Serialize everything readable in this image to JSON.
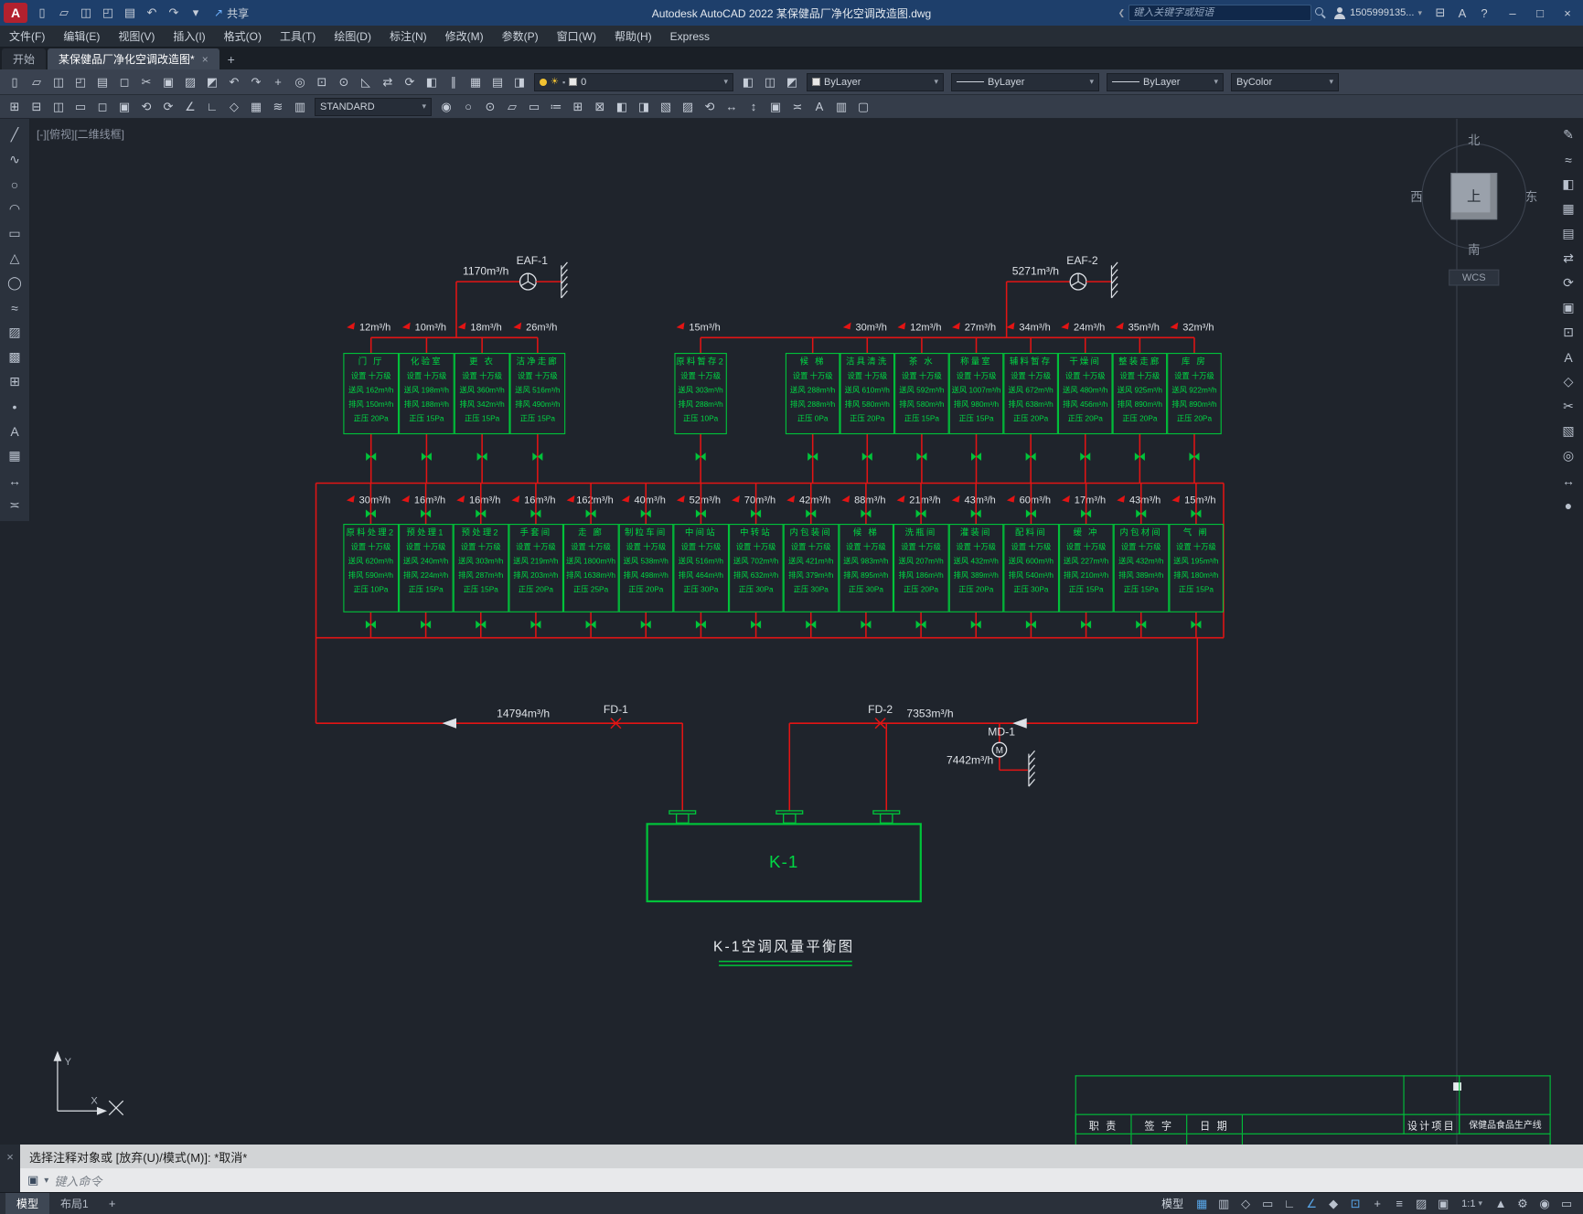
{
  "titlebar": {
    "logo": "A",
    "title": "Autodesk AutoCAD 2022   某保健品厂净化空调改造图.dwg",
    "share": "共享",
    "search_placeholder": "键入关键字或短语",
    "account": "1505999135...",
    "qat": [
      {
        "name": "new-file-icon",
        "glyph": "▯"
      },
      {
        "name": "open-file-icon",
        "glyph": "▱"
      },
      {
        "name": "save-icon",
        "glyph": "◫"
      },
      {
        "name": "save-as-icon",
        "glyph": "◰"
      },
      {
        "name": "plot-icon",
        "glyph": "▤"
      },
      {
        "name": "undo-icon",
        "glyph": "↶"
      },
      {
        "name": "redo-icon",
        "glyph": "↷"
      },
      {
        "name": "qat-menu-icon",
        "glyph": "▾"
      }
    ],
    "right_icons": [
      {
        "name": "cart-icon",
        "glyph": "⊟"
      },
      {
        "name": "autodesk-assistant-icon",
        "glyph": "A"
      },
      {
        "name": "help-icon",
        "glyph": "?"
      }
    ],
    "window_icons": [
      {
        "name": "minimize-button",
        "glyph": "–"
      },
      {
        "name": "maximize-button",
        "glyph": "□"
      },
      {
        "name": "close-button",
        "glyph": "×"
      }
    ]
  },
  "menubar": {
    "items": [
      "文件(F)",
      "编辑(E)",
      "视图(V)",
      "插入(I)",
      "格式(O)",
      "工具(T)",
      "绘图(D)",
      "标注(N)",
      "修改(M)",
      "参数(P)",
      "窗口(W)",
      "帮助(H)",
      "Express"
    ]
  },
  "filetabs": {
    "start": "开始",
    "doc": "某保健品厂净化空调改造图*",
    "close": "×",
    "add": "+"
  },
  "toolbar1": {
    "icons": [
      {
        "name": "new-file-icon",
        "glyph": "▯"
      },
      {
        "name": "open-file-icon",
        "glyph": "▱"
      },
      {
        "name": "save-icon",
        "glyph": "◫"
      },
      {
        "name": "save-as-icon",
        "glyph": "◰"
      },
      {
        "name": "plot-icon",
        "glyph": "▤"
      },
      {
        "name": "plot-preview-icon",
        "glyph": "◻"
      },
      {
        "name": "cut-icon",
        "glyph": "✂"
      },
      {
        "name": "copy-icon",
        "glyph": "▣"
      },
      {
        "name": "paste-icon",
        "glyph": "▨"
      },
      {
        "name": "match-properties-icon",
        "glyph": "◩"
      },
      {
        "name": "undo-icon",
        "glyph": "↶"
      },
      {
        "name": "redo-icon",
        "glyph": "↷"
      },
      {
        "name": "pan-icon",
        "glyph": "+"
      },
      {
        "name": "zoom-realtime-icon",
        "glyph": "◎"
      },
      {
        "name": "zoom-window-icon",
        "glyph": "⊡"
      },
      {
        "name": "zoom-previous-icon",
        "glyph": "⊙"
      },
      {
        "name": "erase-icon",
        "glyph": "◺"
      },
      {
        "name": "move-icon",
        "glyph": "⇄"
      },
      {
        "name": "rotate-icon",
        "glyph": "⟳"
      },
      {
        "name": "mirror-icon",
        "glyph": "◧"
      },
      {
        "name": "offset-icon",
        "glyph": "∥"
      },
      {
        "name": "array-icon",
        "glyph": "▦"
      }
    ],
    "layer_pre_icons": [
      {
        "name": "layer-properties-icon",
        "glyph": "▤"
      },
      {
        "name": "layer-states-icon",
        "glyph": "◨"
      }
    ],
    "layer_post_icons": [
      {
        "name": "make-layer-current-icon",
        "glyph": "◧"
      },
      {
        "name": "layer-previous-icon",
        "glyph": "◫"
      },
      {
        "name": "layer-isolate-icon",
        "glyph": "◩"
      }
    ],
    "layer_value": "0",
    "color_value": "ByLayer",
    "linetype_value": "ByLayer",
    "lineweight_value": "ByLayer",
    "plotstyle_value": "ByColor"
  },
  "toolbar2": {
    "icons_a": [
      {
        "name": "insert-block-icon",
        "glyph": "⊞"
      },
      {
        "name": "external-ref-icon",
        "glyph": "⊟"
      },
      {
        "name": "window-icon",
        "glyph": "◫"
      },
      {
        "name": "viewport-icon",
        "glyph": "▭"
      },
      {
        "name": "named-view-icon",
        "glyph": "◻"
      },
      {
        "name": "sheet-icon",
        "glyph": "▣"
      },
      {
        "name": "regen-icon",
        "glyph": "⟲"
      },
      {
        "name": "redraw-icon",
        "glyph": "⟳"
      },
      {
        "name": "angle-icon",
        "glyph": "∠"
      },
      {
        "name": "ortho-mode-icon",
        "glyph": "∟"
      },
      {
        "name": "isodraft-icon",
        "glyph": "◇"
      },
      {
        "name": "grid-icon",
        "glyph": "▦"
      },
      {
        "name": "multiline-icon",
        "glyph": "≋"
      },
      {
        "name": "layout-icon",
        "glyph": "▥"
      }
    ],
    "style_value": "STANDARD",
    "icons_b": [
      {
        "name": "point-style-icon",
        "glyph": "◉"
      },
      {
        "name": "circle-tool-icon",
        "glyph": "○"
      },
      {
        "name": "donut-icon",
        "glyph": "⊙"
      },
      {
        "name": "rectangle-tool-icon",
        "glyph": "▱"
      },
      {
        "name": "viewport2-icon",
        "glyph": "▭"
      },
      {
        "name": "dim-linear-icon",
        "glyph": "≔"
      },
      {
        "name": "table-icon",
        "glyph": "⊞"
      },
      {
        "name": "block-icon",
        "glyph": "⊠"
      },
      {
        "name": "mirror2-icon",
        "glyph": "◧"
      },
      {
        "name": "fillet-icon",
        "glyph": "◨"
      },
      {
        "name": "hatch-icon",
        "glyph": "▧"
      },
      {
        "name": "gradient-icon",
        "glyph": "▨"
      }
    ],
    "icons_c": [
      {
        "name": "rotate2-icon",
        "glyph": "⟲"
      },
      {
        "name": "stretch-h-icon",
        "glyph": "↔"
      },
      {
        "name": "stretch-v-icon",
        "glyph": "↕"
      },
      {
        "name": "properties-icon",
        "glyph": "▣"
      },
      {
        "name": "measure2-icon",
        "glyph": "≍"
      },
      {
        "name": "text2-icon",
        "glyph": "A"
      },
      {
        "name": "group-icon",
        "glyph": "▥"
      },
      {
        "name": "select-similar-icon",
        "glyph": "▢"
      }
    ]
  },
  "palettes": {
    "left": [
      {
        "name": "line-tool-icon",
        "glyph": "╱"
      },
      {
        "name": "polyline-tool-icon",
        "glyph": "∿"
      },
      {
        "name": "circle-tool-icon",
        "glyph": "○"
      },
      {
        "name": "arc-tool-icon",
        "glyph": "◠"
      },
      {
        "name": "rectangle-tool-icon",
        "glyph": "▭"
      },
      {
        "name": "polygon-tool-icon",
        "glyph": "△"
      },
      {
        "name": "ellipse-tool-icon",
        "glyph": "◯"
      },
      {
        "name": "spline-tool-icon",
        "glyph": "≈"
      },
      {
        "name": "hatch-tool-icon",
        "glyph": "▨"
      },
      {
        "name": "gradient-tool-icon",
        "glyph": "▩"
      },
      {
        "name": "block-tool-icon",
        "glyph": "⊞"
      },
      {
        "name": "point-tool-icon",
        "glyph": "•"
      },
      {
        "name": "text-tool-icon",
        "glyph": "A"
      },
      {
        "name": "table-tool-icon",
        "glyph": "▦"
      },
      {
        "name": "dimension-tool-icon",
        "glyph": "↔"
      },
      {
        "name": "measure-tool-icon",
        "glyph": "≍"
      }
    ],
    "right": [
      {
        "name": "edit-pencil-icon",
        "glyph": "✎"
      },
      {
        "name": "smooth-icon",
        "glyph": "≈"
      },
      {
        "name": "mirror-icon",
        "glyph": "◧"
      },
      {
        "name": "grid-icon",
        "glyph": "▦"
      },
      {
        "name": "panel-icon",
        "glyph": "▤"
      },
      {
        "name": "swap-icon",
        "glyph": "⇄"
      },
      {
        "name": "refresh-icon",
        "glyph": "⟳"
      },
      {
        "name": "layers-icon",
        "glyph": "▣"
      },
      {
        "name": "snap-icon",
        "glyph": "⊡"
      },
      {
        "name": "text-icon",
        "glyph": "A"
      },
      {
        "name": "diamond-icon",
        "glyph": "◇"
      },
      {
        "name": "scissors-icon",
        "glyph": "✂"
      },
      {
        "name": "hatch2-icon",
        "glyph": "▧"
      },
      {
        "name": "target-icon",
        "glyph": "◎"
      },
      {
        "name": "arrows-icon",
        "glyph": "↔"
      },
      {
        "name": "dot-icon",
        "glyph": "●"
      }
    ]
  },
  "canvas": {
    "viewport_label": "[-][俯视][二维线框]",
    "viewcube": {
      "n": "北",
      "s": "南",
      "e": "东",
      "w": "西",
      "top": "上",
      "wcs": "WCS"
    },
    "titleblock": {
      "cols": [
        "职 责",
        "签 字",
        "日 期"
      ],
      "project_label": "设计项目",
      "project_value": "保健品食品生产线"
    },
    "diagram": {
      "labels": {
        "grade": "设置 十万级",
        "supply_prefix": "送风",
        "exhaust_prefix": "排风",
        "pressure_prefix": "正压"
      },
      "fans": [
        {
          "label": "EAF-1",
          "flow": "1170m³/h"
        },
        {
          "label": "EAF-2",
          "flow": "5271m³/h"
        }
      ],
      "row1_groups": [
        [
          {
            "name": "门 厅",
            "leak": "12m³/h",
            "supply": "162m³/h",
            "exhaust": "150m³/h",
            "pressure": "20Pa"
          },
          {
            "name": "化验室",
            "leak": "10m³/h",
            "supply": "198m³/h",
            "exhaust": "188m³/h",
            "pressure": "15Pa"
          },
          {
            "name": "更 衣",
            "leak": "18m³/h",
            "supply": "360m³/h",
            "exhaust": "342m³/h",
            "pressure": "15Pa"
          },
          {
            "name": "洁净走廊",
            "leak": "26m³/h",
            "supply": "516m³/h",
            "exhaust": "490m³/h",
            "pressure": "15Pa"
          }
        ],
        [
          {
            "name": "原料暂存2",
            "leak": "15m³/h",
            "supply": "303m³/h",
            "exhaust": "288m³/h",
            "pressure": "10Pa"
          }
        ],
        [
          {
            "name": "候 梯",
            "leak": null,
            "supply": "288m³/h",
            "exhaust": "288m³/h",
            "pressure": "0Pa"
          },
          {
            "name": "洁具清洗",
            "leak": "30m³/h",
            "supply": "610m³/h",
            "exhaust": "580m³/h",
            "pressure": "20Pa"
          },
          {
            "name": "茶 水",
            "leak": "12m³/h",
            "supply": "592m³/h",
            "exhaust": "580m³/h",
            "pressure": "15Pa"
          },
          {
            "name": "称量室",
            "leak": "27m³/h",
            "supply": "1007m³/h",
            "exhaust": "980m³/h",
            "pressure": "15Pa"
          },
          {
            "name": "辅料暂存",
            "leak": "34m³/h",
            "supply": "672m³/h",
            "exhaust": "638m³/h",
            "pressure": "20Pa"
          },
          {
            "name": "干燥间",
            "leak": "24m³/h",
            "supply": "480m³/h",
            "exhaust": "456m³/h",
            "pressure": "20Pa"
          },
          {
            "name": "整装走廊",
            "leak": "35m³/h",
            "supply": "925m³/h",
            "exhaust": "890m³/h",
            "pressure": "20Pa"
          },
          {
            "name": "库 房",
            "leak": "32m³/h",
            "supply": "922m³/h",
            "exhaust": "890m³/h",
            "pressure": "20Pa"
          }
        ]
      ],
      "row2": [
        {
          "name": "原料处理2",
          "leak": "30m³/h",
          "supply": "620m³/h",
          "exhaust": "590m³/h",
          "pressure": "10Pa"
        },
        {
          "name": "预处理1",
          "leak": "16m³/h",
          "supply": "240m³/h",
          "exhaust": "224m³/h",
          "pressure": "15Pa"
        },
        {
          "name": "预处理2",
          "leak": "16m³/h",
          "supply": "303m³/h",
          "exhaust": "287m³/h",
          "pressure": "15Pa"
        },
        {
          "name": "手套间",
          "leak": "16m³/h",
          "supply": "219m³/h",
          "exhaust": "203m³/h",
          "pressure": "20Pa"
        },
        {
          "name": "走 廊",
          "leak": "162m³/h",
          "supply": "1800m³/h",
          "exhaust": "1638m³/h",
          "pressure": "25Pa"
        },
        {
          "name": "制粒车间",
          "leak": "40m³/h",
          "supply": "538m³/h",
          "exhaust": "498m³/h",
          "pressure": "20Pa"
        },
        {
          "name": "中间站",
          "leak": "52m³/h",
          "supply": "516m³/h",
          "exhaust": "464m³/h",
          "pressure": "30Pa"
        },
        {
          "name": "中转站",
          "leak": "70m³/h",
          "supply": "702m³/h",
          "exhaust": "632m³/h",
          "pressure": "30Pa"
        },
        {
          "name": "内包装间",
          "leak": "42m³/h",
          "supply": "421m³/h",
          "exhaust": "379m³/h",
          "pressure": "30Pa"
        },
        {
          "name": "候 梯",
          "leak": "88m³/h",
          "supply": "983m³/h",
          "exhaust": "895m³/h",
          "pressure": "30Pa"
        },
        {
          "name": "洗瓶间",
          "leak": "21m³/h",
          "supply": "207m³/h",
          "exhaust": "186m³/h",
          "pressure": "20Pa"
        },
        {
          "name": "灌装间",
          "leak": "43m³/h",
          "supply": "432m³/h",
          "exhaust": "389m³/h",
          "pressure": "20Pa"
        },
        {
          "name": "配料间",
          "leak": "60m³/h",
          "supply": "600m³/h",
          "exhaust": "540m³/h",
          "pressure": "30Pa"
        },
        {
          "name": "缓 冲",
          "leak": "17m³/h",
          "supply": "227m³/h",
          "exhaust": "210m³/h",
          "pressure": "15Pa"
        },
        {
          "name": "内包材间",
          "leak": "43m³/h",
          "supply": "432m³/h",
          "exhaust": "389m³/h",
          "pressure": "15Pa"
        },
        {
          "name": "气 闸",
          "leak": "15m³/h",
          "supply": "195m³/h",
          "exhaust": "180m³/h",
          "pressure": "15Pa"
        }
      ],
      "bottom": {
        "left_flow": "14794m³/h",
        "fd1": "FD-1",
        "fd2": "FD-2",
        "right_flow": "7353m³/h",
        "md": "MD-1",
        "md_flow": "7442m³/h",
        "unit": "K-1",
        "caption": "K-1空调风量平衡图"
      },
      "ucs": {
        "x_label": "X",
        "y_label": "Y"
      }
    }
  },
  "command": {
    "history": "选择注释对象或 [放弃(U)/模式(M)]: *取消*",
    "prompt": "键入命令"
  },
  "statusbar": {
    "sheet_tabs": [
      {
        "label": "模型",
        "active": true
      },
      {
        "label": "布局1",
        "active": false
      }
    ],
    "add_tab": "+",
    "model_label": "模型",
    "scale": "1:1",
    "icons_a": [
      {
        "name": "grid-display-icon",
        "glyph": "▦",
        "active": true
      },
      {
        "name": "snap-mode-icon",
        "glyph": "▥"
      },
      {
        "name": "infer-constraints-icon",
        "glyph": "◇"
      },
      {
        "name": "dynamic-input-icon",
        "glyph": "▭"
      },
      {
        "name": "ortho-mode-icon",
        "glyph": "∟"
      },
      {
        "name": "polar-tracking-icon",
        "glyph": "∠",
        "active": true
      },
      {
        "name": "isodraft-icon",
        "glyph": "◆"
      },
      {
        "name": "object-snap-icon",
        "glyph": "⊡",
        "active": true
      },
      {
        "name": "object-track-icon",
        "glyph": "+"
      },
      {
        "name": "lineweight-display-icon",
        "glyph": "≡"
      },
      {
        "name": "transparency-icon",
        "glyph": "▨"
      },
      {
        "name": "selection-cycling-icon",
        "glyph": "▣"
      }
    ],
    "icons_b": [
      {
        "name": "annotation-visibility-icon",
        "glyph": "▲"
      },
      {
        "name": "workspace-gear-icon",
        "glyph": "⚙"
      },
      {
        "name": "isolate-objects-icon",
        "glyph": "◉"
      },
      {
        "name": "clean-screen-icon",
        "glyph": "▭"
      }
    ]
  }
}
